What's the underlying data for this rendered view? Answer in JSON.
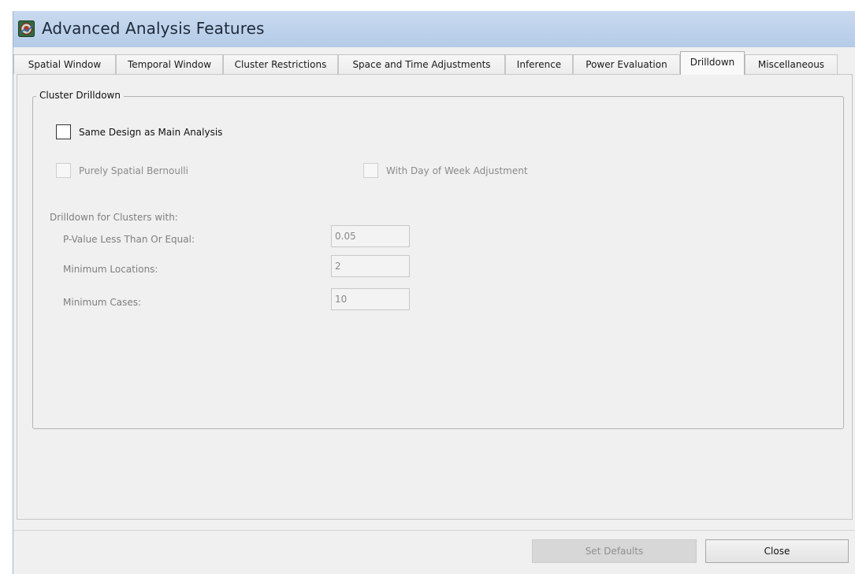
{
  "window": {
    "title": "Advanced Analysis Features",
    "icon": "satscan-app-icon"
  },
  "tabs": [
    {
      "label": "Spatial Window",
      "active": false
    },
    {
      "label": "Temporal Window",
      "active": false
    },
    {
      "label": "Cluster Restrictions",
      "active": false
    },
    {
      "label": "Space and Time Adjustments",
      "active": false
    },
    {
      "label": "Inference",
      "active": false
    },
    {
      "label": "Power Evaluation",
      "active": false
    },
    {
      "label": "Drilldown",
      "active": true
    },
    {
      "label": "Miscellaneous",
      "active": false
    }
  ],
  "drilldown": {
    "group_title": "Cluster Drilldown",
    "same_design_label": "Same Design as Main Analysis",
    "purely_spatial_label": "Purely Spatial Bernoulli",
    "day_of_week_label": "With Day of Week Adjustment",
    "section_label": "Drilldown for Clusters with:",
    "pvalue_label": "P-Value Less Than Or Equal:",
    "pvalue_value": "0.05",
    "min_locations_label": "Minimum Locations:",
    "min_locations_value": "2",
    "min_cases_label": "Minimum Cases:",
    "min_cases_value": "10"
  },
  "buttons": {
    "set_defaults": "Set Defaults",
    "close": "Close"
  }
}
